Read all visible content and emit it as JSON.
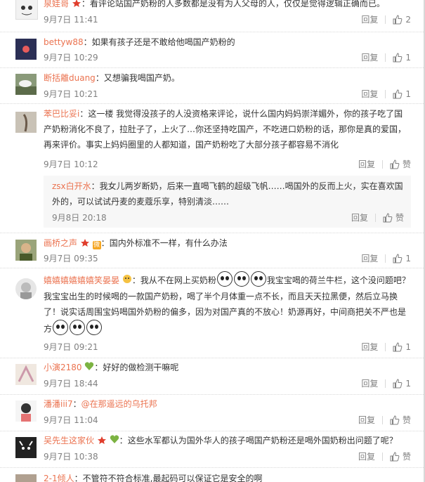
{
  "ui": {
    "reply": "回复",
    "like_word": "赞"
  },
  "colors": {
    "name": "#eb7350",
    "meta": "#808080",
    "text": "#333333"
  },
  "comments": [
    {
      "name": "泉娃哥",
      "text": "看评论站国产奶粉的人多数都是没有为人父母的人，仅仅是觉得逻辑正确而已。",
      "time": "9月7日 11:41",
      "likes": "2"
    },
    {
      "name": "bettyw88",
      "text": "如果有孩子还是不敢给他喝国产奶粉的",
      "time": "9月7日 10:29",
      "likes": "1"
    },
    {
      "name": "断括離duang",
      "text": "又想骗我喝国产奶。",
      "time": "9月7日 10:21",
      "likes": "1"
    },
    {
      "name": "苯巴比妥i",
      "text": "这一楼 我觉得没孩子的人没资格来评论，说什么国内妈妈崇洋媚外，你的孩子吃了国产奶粉消化不良了，拉肚子了，上火了…你还坚持吃国产，不吃进口奶粉的话，那你是真的爱国，再来评价。事实上妈妈圈里的人都知道，国产奶粉吃了大部分孩子都容易不消化",
      "time": "9月7日 10:12",
      "likes": "赞"
    },
    {
      "name": "zsx白开水",
      "text": "我女儿两岁断奶，后来一直喝飞鹤的超级飞帆……喝国外的反而上火，实在喜欢国外的，可以试试丹麦的麦蔻乐享，特别清淡……",
      "time": "9月8日 20:18",
      "likes": "赞"
    },
    {
      "name": "画桥之声",
      "text": "国内外标准不一样，有什么办法",
      "time": "9月7日 09:35",
      "likes": "1"
    },
    {
      "name": "嬉嬉嬉嬉嬉嬉笑晏晏",
      "text_a": "我从不在网上买奶粉",
      "text_b": "我宝宝喝的荷兰牛栏，这个没问题吧？我宝宝出生的时候喝的一款国产奶粉，喝了半个月体重一点不长，而且天天拉黑便，然后立马换了！说实话周围宝妈喝国外奶粉的偏多，因为对国产真的不放心！奶源再好，中间商把关不严也是方",
      "time": "9月7日 09:21",
      "likes": "1"
    },
    {
      "name": "小演2180",
      "text": "好好的做检测干嘛呢",
      "time": "9月7日 18:44",
      "likes": "1"
    },
    {
      "name": "潘潘iii7",
      "text": "@在那遥远的乌托邦",
      "time": "9月7日 11:04",
      "likes": "赞"
    },
    {
      "name": "吴先生这家伙",
      "text": "这些水军都认为国外华人的孩子喝国产奶粉还是喝外国奶粉出问题了呢？",
      "time": "9月7日 10:38",
      "likes": "赞"
    },
    {
      "name": "2-1倾人",
      "text": "不管符不符合标准,最起码可以保证它是安全的啊",
      "time": "",
      "likes": ""
    }
  ]
}
